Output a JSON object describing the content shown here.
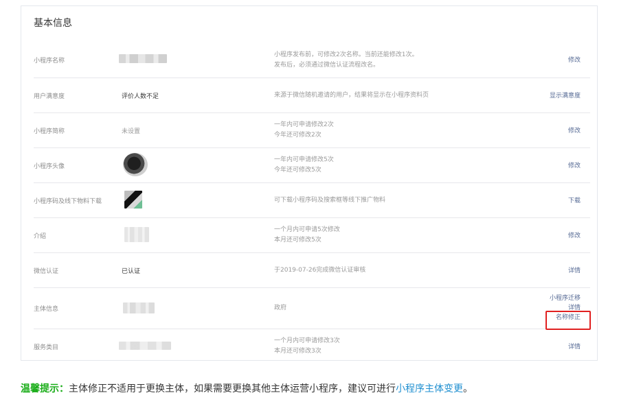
{
  "panel": {
    "title": "基本信息"
  },
  "rows": [
    {
      "label": "小程序名称",
      "value": "",
      "desc1": "小程序发布前，可修改2次名称。当前还能修改1次。",
      "desc2": "发布后，必须通过微信认证流程改名。",
      "actions": [
        "修改"
      ]
    },
    {
      "label": "用户满意度",
      "value": "评价人数不足",
      "desc1": "来源于微信随机邀请的用户，结果将显示在小程序资料页",
      "desc2": "",
      "actions": [
        "显示满意度"
      ]
    },
    {
      "label": "小程序简称",
      "value": "未设置",
      "desc1": "一年内可申请修改2次",
      "desc2": "今年还可修改2次",
      "actions": [
        "修改"
      ]
    },
    {
      "label": "小程序头像",
      "value": "",
      "desc1": "一年内可申请修改5次",
      "desc2": "今年还可修改5次",
      "actions": [
        "修改"
      ]
    },
    {
      "label": "小程序码及线下物料下载",
      "value": "",
      "desc1": "可下载小程序码及搜索框等线下推广物料",
      "desc2": "",
      "actions": [
        "下载"
      ]
    },
    {
      "label": "介绍",
      "value": "",
      "desc1": "一个月内可申请5次修改",
      "desc2": "本月还可修改5次",
      "actions": [
        "修改"
      ]
    },
    {
      "label": "微信认证",
      "value": "已认证",
      "desc1": "于2019-07-26完成微信认证审核",
      "desc2": "",
      "actions": [
        "详情"
      ]
    },
    {
      "label": "主体信息",
      "value": "",
      "desc1": "政府",
      "desc2": "",
      "actions": [
        "小程序迁移",
        "详情",
        "名称修正"
      ]
    },
    {
      "label": "服务类目",
      "value": "",
      "desc1": "一个月内可申请修改3次",
      "desc2": "本月还可修改3次",
      "actions": [
        "详情"
      ]
    }
  ],
  "tip": {
    "label": "温馨提示：",
    "text": "主体修正不适用于更换主体，如果需要更换其他主体运营小程序，建议可进行",
    "link": "小程序主体变更",
    "end": "。"
  },
  "colors": {
    "link": "#576b95",
    "tip_label": "#1aad19",
    "tip_link": "#1f8fd0",
    "highlight": "#e02020"
  }
}
